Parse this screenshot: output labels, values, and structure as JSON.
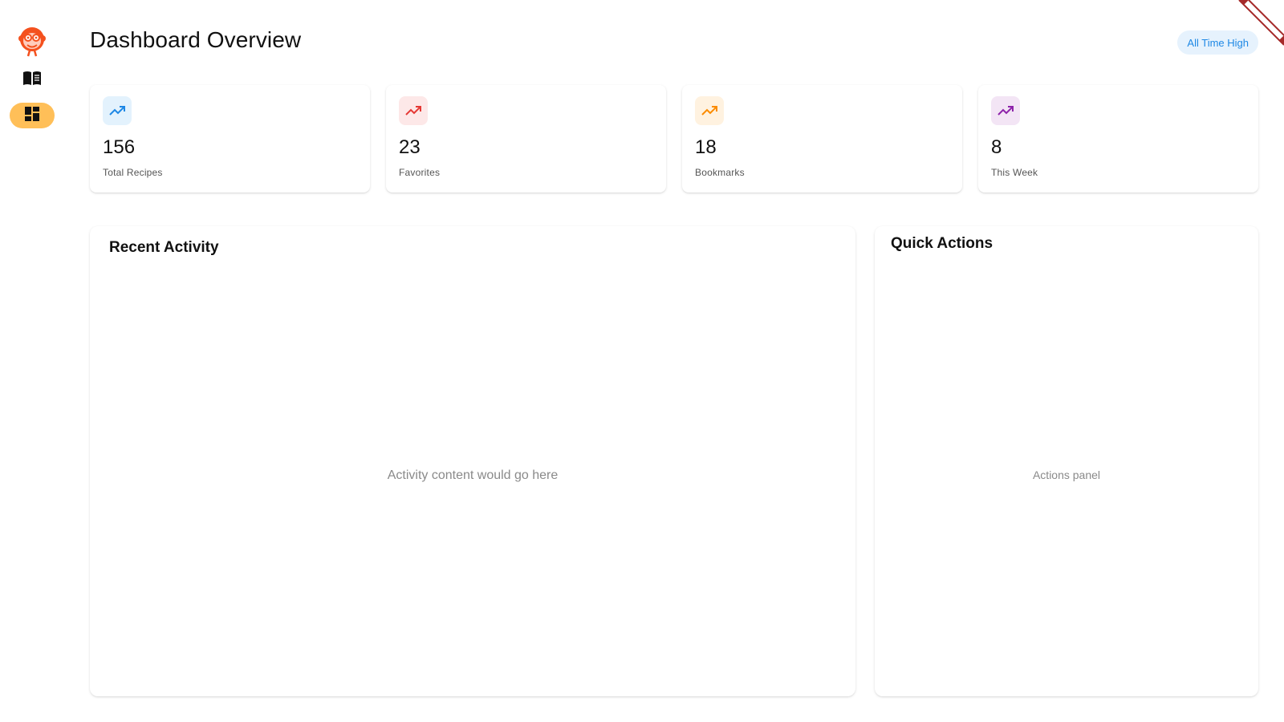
{
  "header": {
    "title": "Dashboard Overview",
    "chip_label": "All Time High"
  },
  "nav": {
    "items": [
      {
        "name": "recipes",
        "icon": "menu-book-icon",
        "active": false
      },
      {
        "name": "dashboard",
        "icon": "dashboard-icon",
        "active": true
      }
    ]
  },
  "stats": [
    {
      "value": "156",
      "label": "Total Recipes",
      "icon": "trending-up-icon",
      "color": "#1e88e5",
      "bg": "#e3f2fd"
    },
    {
      "value": "23",
      "label": "Favorites",
      "icon": "trending-up-icon",
      "color": "#e53935",
      "bg": "#fde8e8"
    },
    {
      "value": "18",
      "label": "Bookmarks",
      "icon": "trending-up-icon",
      "color": "#fb8c00",
      "bg": "#fff2e0"
    },
    {
      "value": "8",
      "label": "This Week",
      "icon": "trending-up-icon",
      "color": "#8e24aa",
      "bg": "#f3e5f5"
    }
  ],
  "activity": {
    "title": "Recent Activity",
    "placeholder": "Activity content would go here"
  },
  "actions": {
    "title": "Quick Actions",
    "placeholder": "Actions panel"
  },
  "colors": {
    "active_nav": "#ffbf58",
    "chip_bg": "#e6f2fd",
    "chip_text": "#1e88e5",
    "logo": "#f4511e"
  }
}
